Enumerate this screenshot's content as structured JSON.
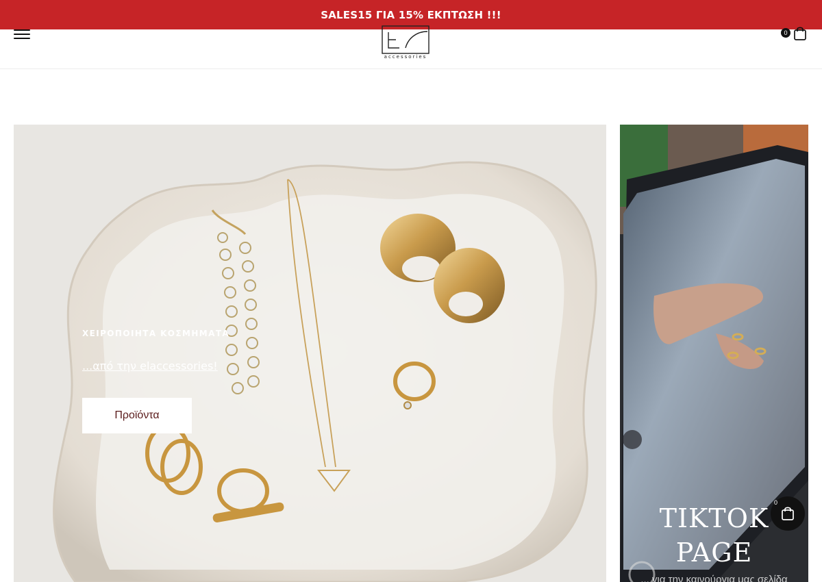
{
  "promo": {
    "text": "SALES15 ΓΙΑ 15% ΕΚΠΤΩΣΗ !!!"
  },
  "header": {
    "logo_text": "accessories",
    "cart_count": "0",
    "icons": {
      "menu": "hamburger-menu-icon",
      "cart": "shopping-bag-icon"
    }
  },
  "hero": {
    "kicker": "ΧΕΙΡΟΠΟΙΗΤΑ ΚΟΣΜΗΜΑΤΑ",
    "subtitle": "...από την elaccessories!",
    "button_label": "Προϊόντα"
  },
  "tiktok": {
    "title_line1": "TIKTOK",
    "title_line2": "PAGE",
    "caption": "... για την καινούργια μας σελίδα"
  },
  "floating_cart": {
    "count": "0"
  },
  "colors": {
    "promo_bg": "#c62427",
    "button_text": "#5a1b1b",
    "cart_bg": "#111111"
  }
}
